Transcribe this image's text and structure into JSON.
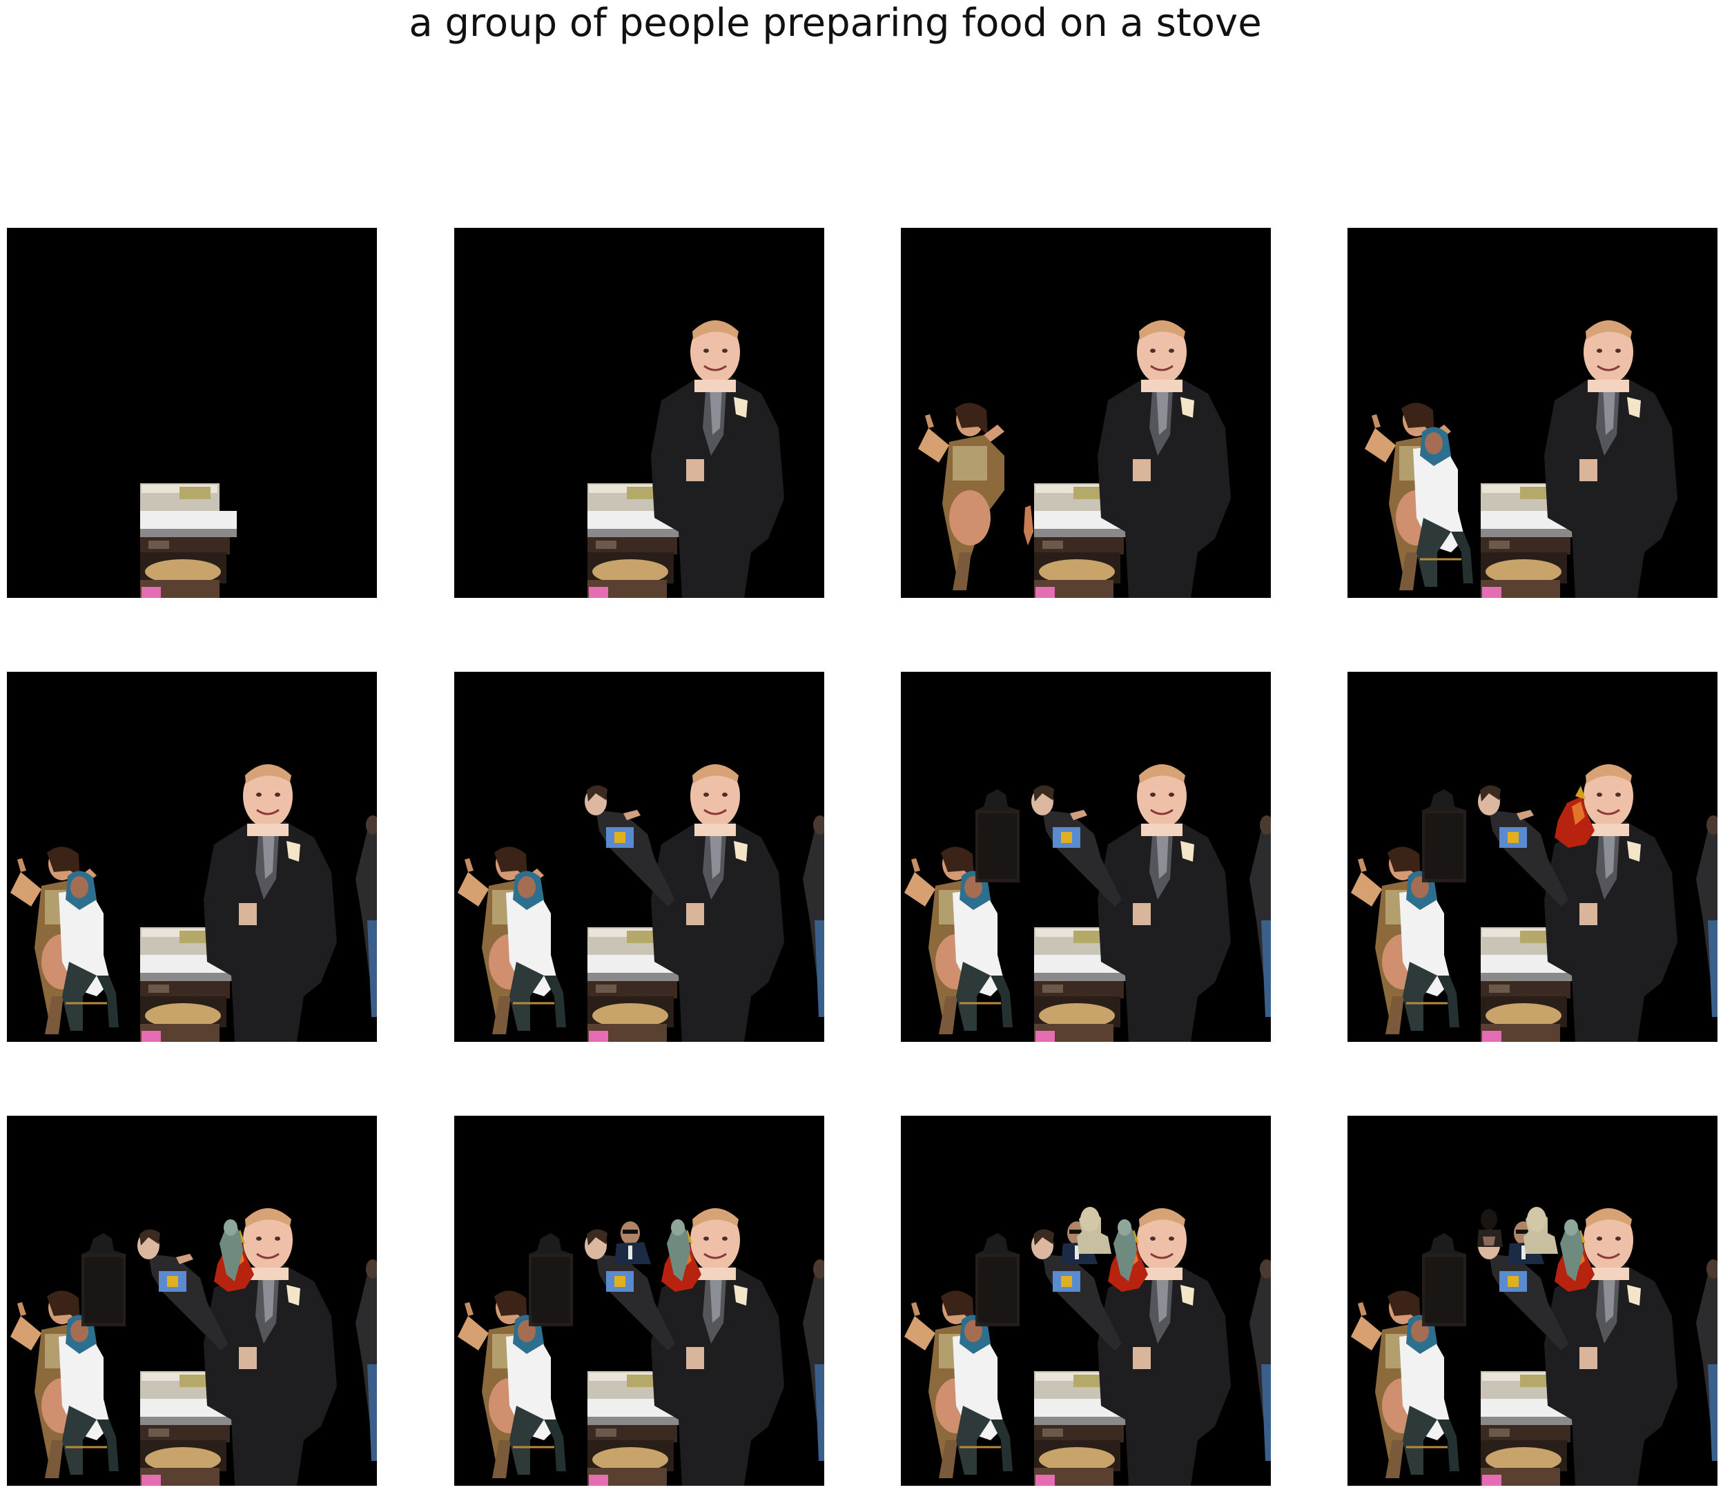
{
  "caption": "a group of people preparing food on a stove",
  "panels": [
    {
      "step": 1,
      "objects": [
        "stove"
      ]
    },
    {
      "step": 2,
      "objects": [
        "stove",
        "man-in-suit"
      ]
    },
    {
      "step": 3,
      "objects": [
        "stove",
        "man-in-suit",
        "woman-posing",
        "small-figure"
      ]
    },
    {
      "step": 4,
      "objects": [
        "stove",
        "man-in-suit",
        "woman-posing",
        "seated-person"
      ]
    },
    {
      "step": 5,
      "objects": [
        "stove",
        "man-in-suit",
        "woman-posing",
        "seated-person",
        "edge-person"
      ]
    },
    {
      "step": 6,
      "objects": [
        "stove",
        "man-in-suit",
        "woman-posing",
        "seated-person",
        "edge-person",
        "running-figure"
      ]
    },
    {
      "step": 7,
      "objects": [
        "stove",
        "man-in-suit",
        "woman-posing",
        "seated-person",
        "edge-person",
        "running-figure",
        "dark-silhouette"
      ]
    },
    {
      "step": 8,
      "objects": [
        "stove",
        "man-in-suit",
        "woman-posing",
        "seated-person",
        "edge-person",
        "running-figure",
        "dark-silhouette",
        "red-cloth"
      ]
    },
    {
      "step": 9,
      "objects": [
        "stove",
        "man-in-suit",
        "woman-posing",
        "seated-person",
        "edge-person",
        "running-figure",
        "dark-silhouette",
        "red-cloth",
        "statue-figure"
      ]
    },
    {
      "step": 10,
      "objects": [
        "stove",
        "man-in-suit",
        "woman-posing",
        "seated-person",
        "edge-person",
        "running-figure",
        "dark-silhouette",
        "red-cloth",
        "statue-figure",
        "sunglasses-man"
      ]
    },
    {
      "step": 11,
      "objects": [
        "stove",
        "man-in-suit",
        "woman-posing",
        "seated-person",
        "edge-person",
        "running-figure",
        "dark-silhouette",
        "red-cloth",
        "statue-figure",
        "sunglasses-man",
        "bust-figure"
      ]
    },
    {
      "step": 12,
      "objects": [
        "stove",
        "man-in-suit",
        "woman-posing",
        "seated-person",
        "edge-person",
        "running-figure",
        "dark-silhouette",
        "red-cloth",
        "statue-figure",
        "sunglasses-man",
        "bust-figure",
        "dark-head"
      ]
    }
  ]
}
